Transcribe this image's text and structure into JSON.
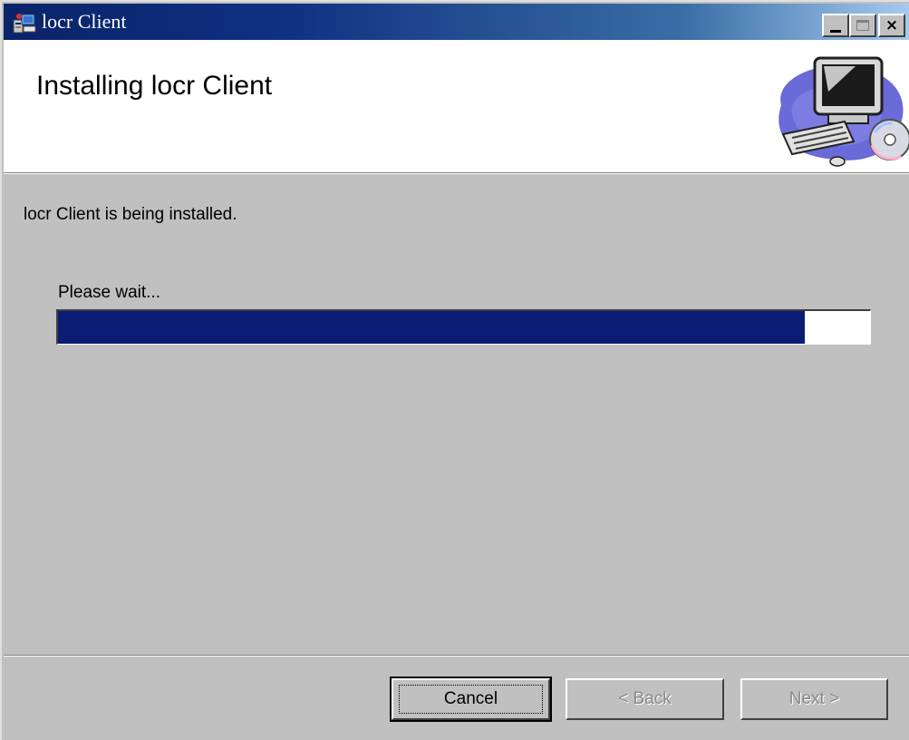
{
  "window": {
    "title": "locr Client",
    "controls": {
      "minimize": "minimize",
      "maximize": "maximize",
      "close": "×"
    }
  },
  "banner": {
    "title": "Installing locr Client",
    "art_icon": "computer-setup-icon"
  },
  "main": {
    "status": "locr Client is being installed.",
    "wait_label": "Please wait...",
    "progress_fraction": 0.92
  },
  "buttons": {
    "cancel": "Cancel",
    "back": "< Back",
    "next": "Next >"
  },
  "colors": {
    "titlebar_start": "#0a246a",
    "titlebar_end": "#a6caf0",
    "progress_fill": "#0a1c74",
    "window_bg": "#c0c0c0"
  }
}
